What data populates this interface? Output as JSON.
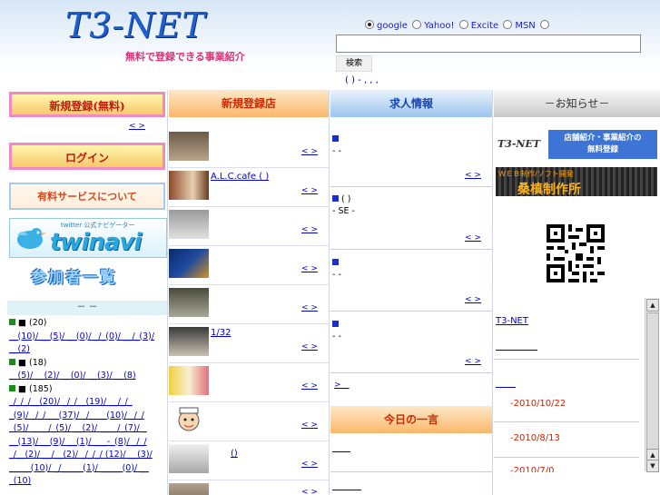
{
  "header": {
    "logo": "T3-NET",
    "tagline": "無料で登録できる事業紹介",
    "engines": [
      "google",
      "Yahoo!",
      "Excite",
      "MSN"
    ],
    "selected_engine": "google",
    "search_button": "検索",
    "links_line": "( ) -     , , ,"
  },
  "col1": {
    "register_button": "新規登録(無料)",
    "more": "<     >",
    "login_button": "ログイン",
    "paid_button": "有料サービスについて",
    "twinavi_text": "twinavi",
    "twinavi_sub": "twitter 公式ナビゲーター",
    "members_button": "参加者一覧",
    "category_header": "－   －",
    "categories": [
      {
        "title": "■ (20)",
        "lines": [
          "__(10)/ __(5)/ __(0)/ _/_(0)/ __/_(3)/",
          "__(2)"
        ]
      },
      {
        "title": "■ (18)",
        "lines": [
          "__(5)/ __(2)/ __(0)/ __(3)/ __(8)"
        ]
      },
      {
        "title": "■ (185)",
        "lines": [
          "_/_/_/__(20)/ _/_/__(19)/ __/_/_",
          "_(9)/ _/_/___(37)/ _/____(10)/ _/_/",
          "_(5)/ ____/_(5)/ __(2)/ ____/_(7)/ _",
          "__(13)/ __(9)/ __(1)/ ___-_(8)/ _/_/",
          "_/__(2)/ __/__(2)/ _/_/_/ (12)/ __(3)/",
          "_____(10)/ _/_____(1)/ _____(0)/ __",
          "_(10)"
        ]
      }
    ]
  },
  "col2": {
    "header": "新規登録店",
    "more": "<   >",
    "shops": [
      {
        "name": ""
      },
      {
        "name": "A.L.C.cafe (        )"
      },
      {
        "name": ""
      },
      {
        "name": ""
      },
      {
        "name": ""
      },
      {
        "name": "1/32"
      },
      {
        "name": ""
      },
      {
        "name": ""
      },
      {
        "name": "()"
      },
      {
        "name": ""
      }
    ]
  },
  "col3": {
    "header": "求人情報",
    "more": "<   >",
    "jobs": [
      {
        "title": "",
        "lines": [
          "-                    -"
        ]
      },
      {
        "title": "(   )",
        "lines": [
          "- SE  -"
        ]
      },
      {
        "title": "",
        "lines": [
          "-              -"
        ]
      },
      {
        "title": "",
        "lines": [
          "-        -"
        ]
      }
    ],
    "arrow_link": ">__",
    "quote_header": "今日の一言"
  },
  "col4": {
    "header": "－お知らせ－",
    "banner1_logo": "T3-NET",
    "banner1_text1": "店舗紹介・事業紹介の",
    "banner1_text2": "無料登録",
    "banner2_sub": "ＷＥＢ制作/ソフト開発",
    "banner2_main": "桑槙制作所",
    "news_title": "T3-NET  ",
    "news_dates": [
      "-2010/10/22",
      "-2010/8/13",
      "-2010/7/0"
    ]
  }
}
